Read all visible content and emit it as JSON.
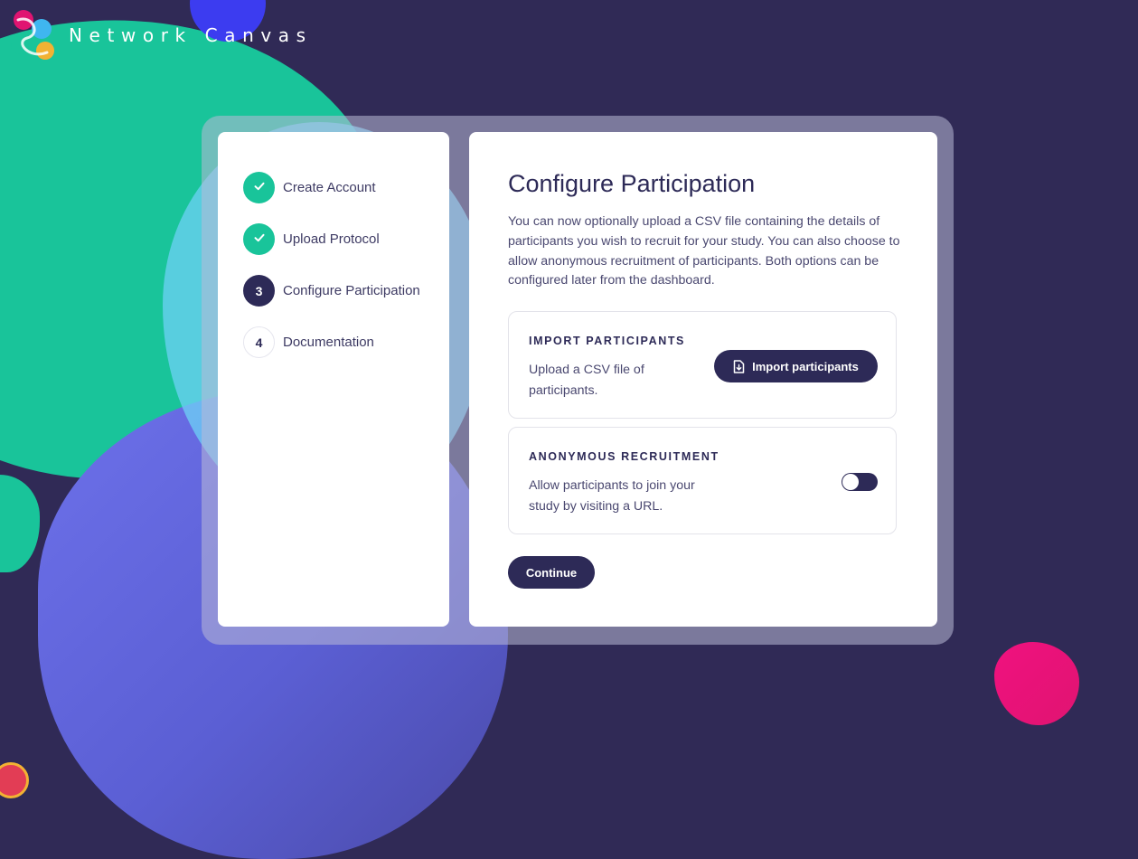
{
  "app": {
    "name": "Network Canvas"
  },
  "steps": [
    {
      "label": "Create Account",
      "number": "1",
      "state": "done"
    },
    {
      "label": "Upload Protocol",
      "number": "2",
      "state": "done"
    },
    {
      "label": "Configure Participation",
      "number": "3",
      "state": "active"
    },
    {
      "label": "Documentation",
      "number": "4",
      "state": "todo"
    }
  ],
  "main": {
    "title": "Configure Participation",
    "description": "You can now optionally upload a CSV file containing the details of participants you wish to recruit for your study. You can also choose to allow anonymous recruitment of participants. Both options can be configured later from the dashboard.",
    "import_card": {
      "title": "IMPORT PARTICIPANTS",
      "description": "Upload a CSV file of participants.",
      "button_label": "Import participants"
    },
    "anonymous_card": {
      "title": "ANONYMOUS RECRUITMENT",
      "description": "Allow participants to join your study by visiting a URL.",
      "toggle_on": false
    },
    "continue_label": "Continue"
  },
  "colors": {
    "background": "#302a56",
    "primary": "#2d2a57",
    "success": "#19c49a",
    "accent_pink": "#e01471"
  },
  "icons": {
    "check": "check-icon",
    "file_import": "file-import-icon"
  }
}
